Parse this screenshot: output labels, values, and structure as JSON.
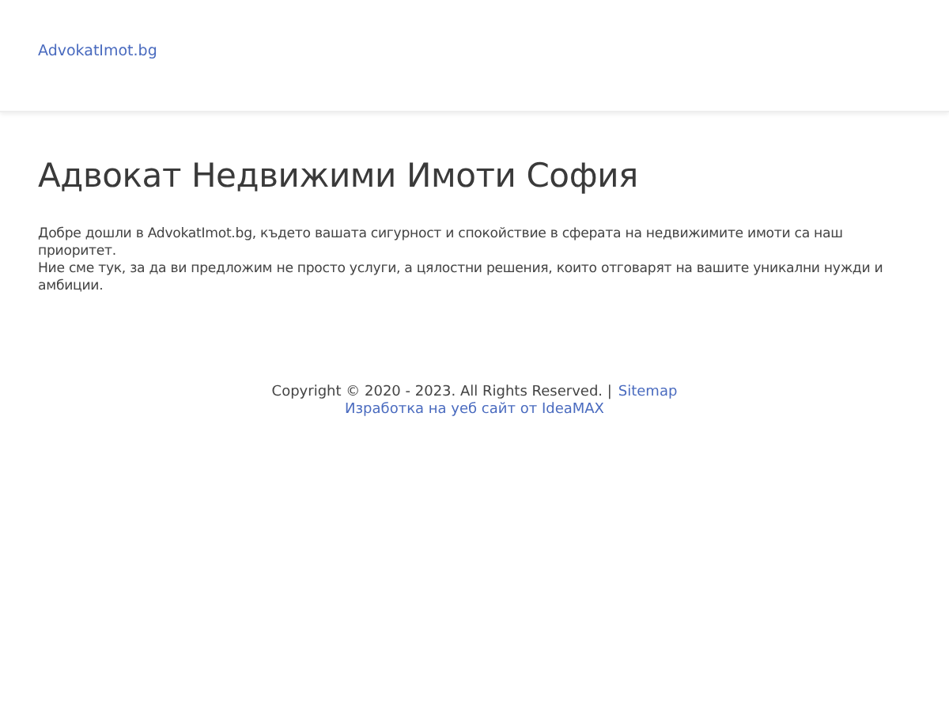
{
  "header": {
    "logo": "AdvokatImot.bg"
  },
  "main": {
    "title": "Адвокат Недвижими Имоти София",
    "intro_lines": [
      "Добре дошли в AdvokatImot.bg, където вашата сигурност и спокойствие в сферата на недвижимите имоти са наш приоритет.",
      "Ние сме тук, за да ви предложим не просто услуги, а цялостни решения, които отговарят на вашите уникални нужди и амбиции."
    ]
  },
  "footer": {
    "copyright": "Copyright © 2020 - 2023. All Rights Reserved. |",
    "sitemap_link": "Sitemap",
    "credit_link": "Изработка на уеб сайт от IdeaMAX"
  }
}
